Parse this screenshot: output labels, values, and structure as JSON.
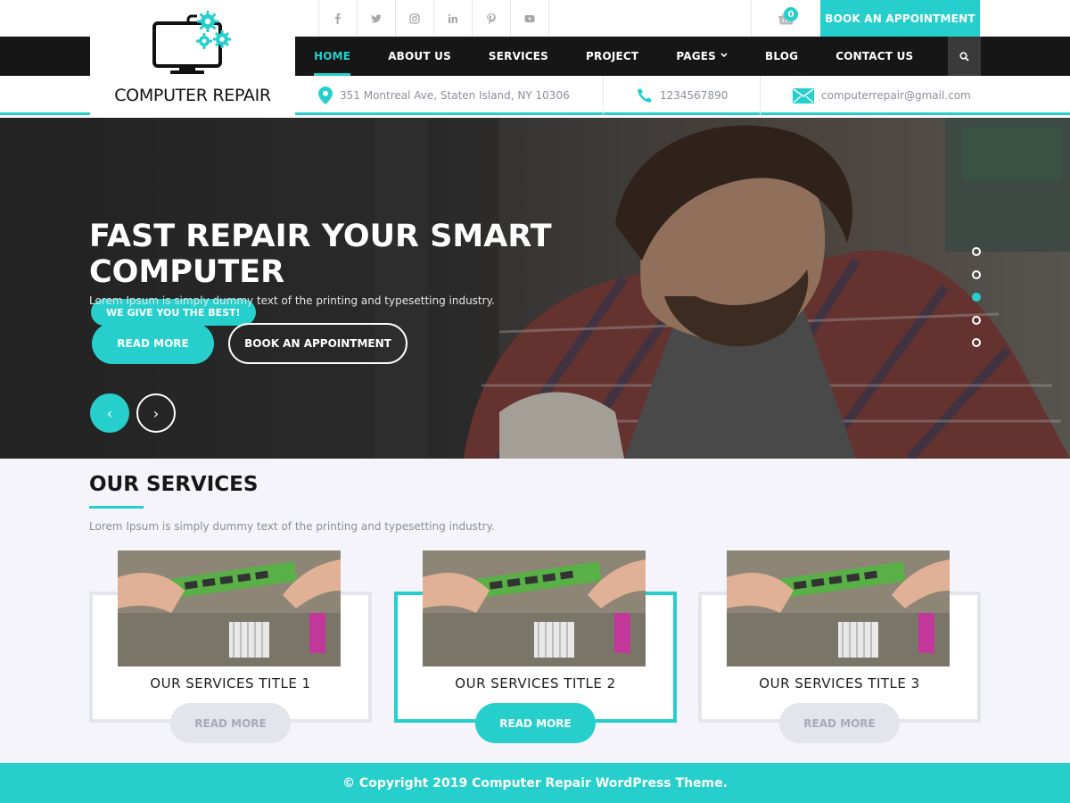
{
  "brand": {
    "name": "COMPUTER REPAIR",
    "accent_color": "#26cfcc",
    "logo_icon": "monitor-with-gears-icon"
  },
  "top_bar": {
    "social_icons": [
      "facebook-icon",
      "twitter-icon",
      "instagram-icon",
      "linkedin-icon",
      "pinterest-icon",
      "youtube-icon"
    ],
    "cart_count": "0",
    "appointment_label": "BOOK AN APPOINTMENT"
  },
  "nav": {
    "items": [
      {
        "label": "HOME",
        "active": true
      },
      {
        "label": "ABOUT US"
      },
      {
        "label": "SERVICES"
      },
      {
        "label": "PROJECT"
      },
      {
        "label": "PAGES",
        "has_dropdown": true
      },
      {
        "label": "BLOG"
      },
      {
        "label": "CONTACT US"
      }
    ]
  },
  "contact": {
    "address": "351 Montreal Ave, Staten Island, NY 10306",
    "phone": "1234567890",
    "email": "computerrepair@gmail.com"
  },
  "hero": {
    "tag": "WE GIVE YOU THE BEST!",
    "title_line1": "FAST REPAIR YOUR SMART",
    "title_line2": "COMPUTER",
    "subtitle": "Lorem Ipsum is simply dummy text of the printing and typesetting industry.",
    "primary_button": "READ MORE",
    "secondary_button": "BOOK AN APPOINTMENT",
    "prev_arrow": "‹",
    "next_arrow": "›",
    "slide_count": 5,
    "active_slide": 3
  },
  "services": {
    "heading": "OUR SERVICES",
    "subtitle": "Lorem Ipsum is simply dummy text of the printing and typesetting industry.",
    "cards": [
      {
        "title": "OUR SERVICES TITLE 1",
        "button": "READ MORE",
        "active": false
      },
      {
        "title": "OUR SERVICES TITLE 2",
        "button": "READ MORE",
        "active": true
      },
      {
        "title": "OUR SERVICES TITLE 3",
        "button": "READ MORE",
        "active": false
      }
    ]
  },
  "footer": {
    "copyright": "© Copyright 2019 Computer Repair WordPress Theme."
  }
}
